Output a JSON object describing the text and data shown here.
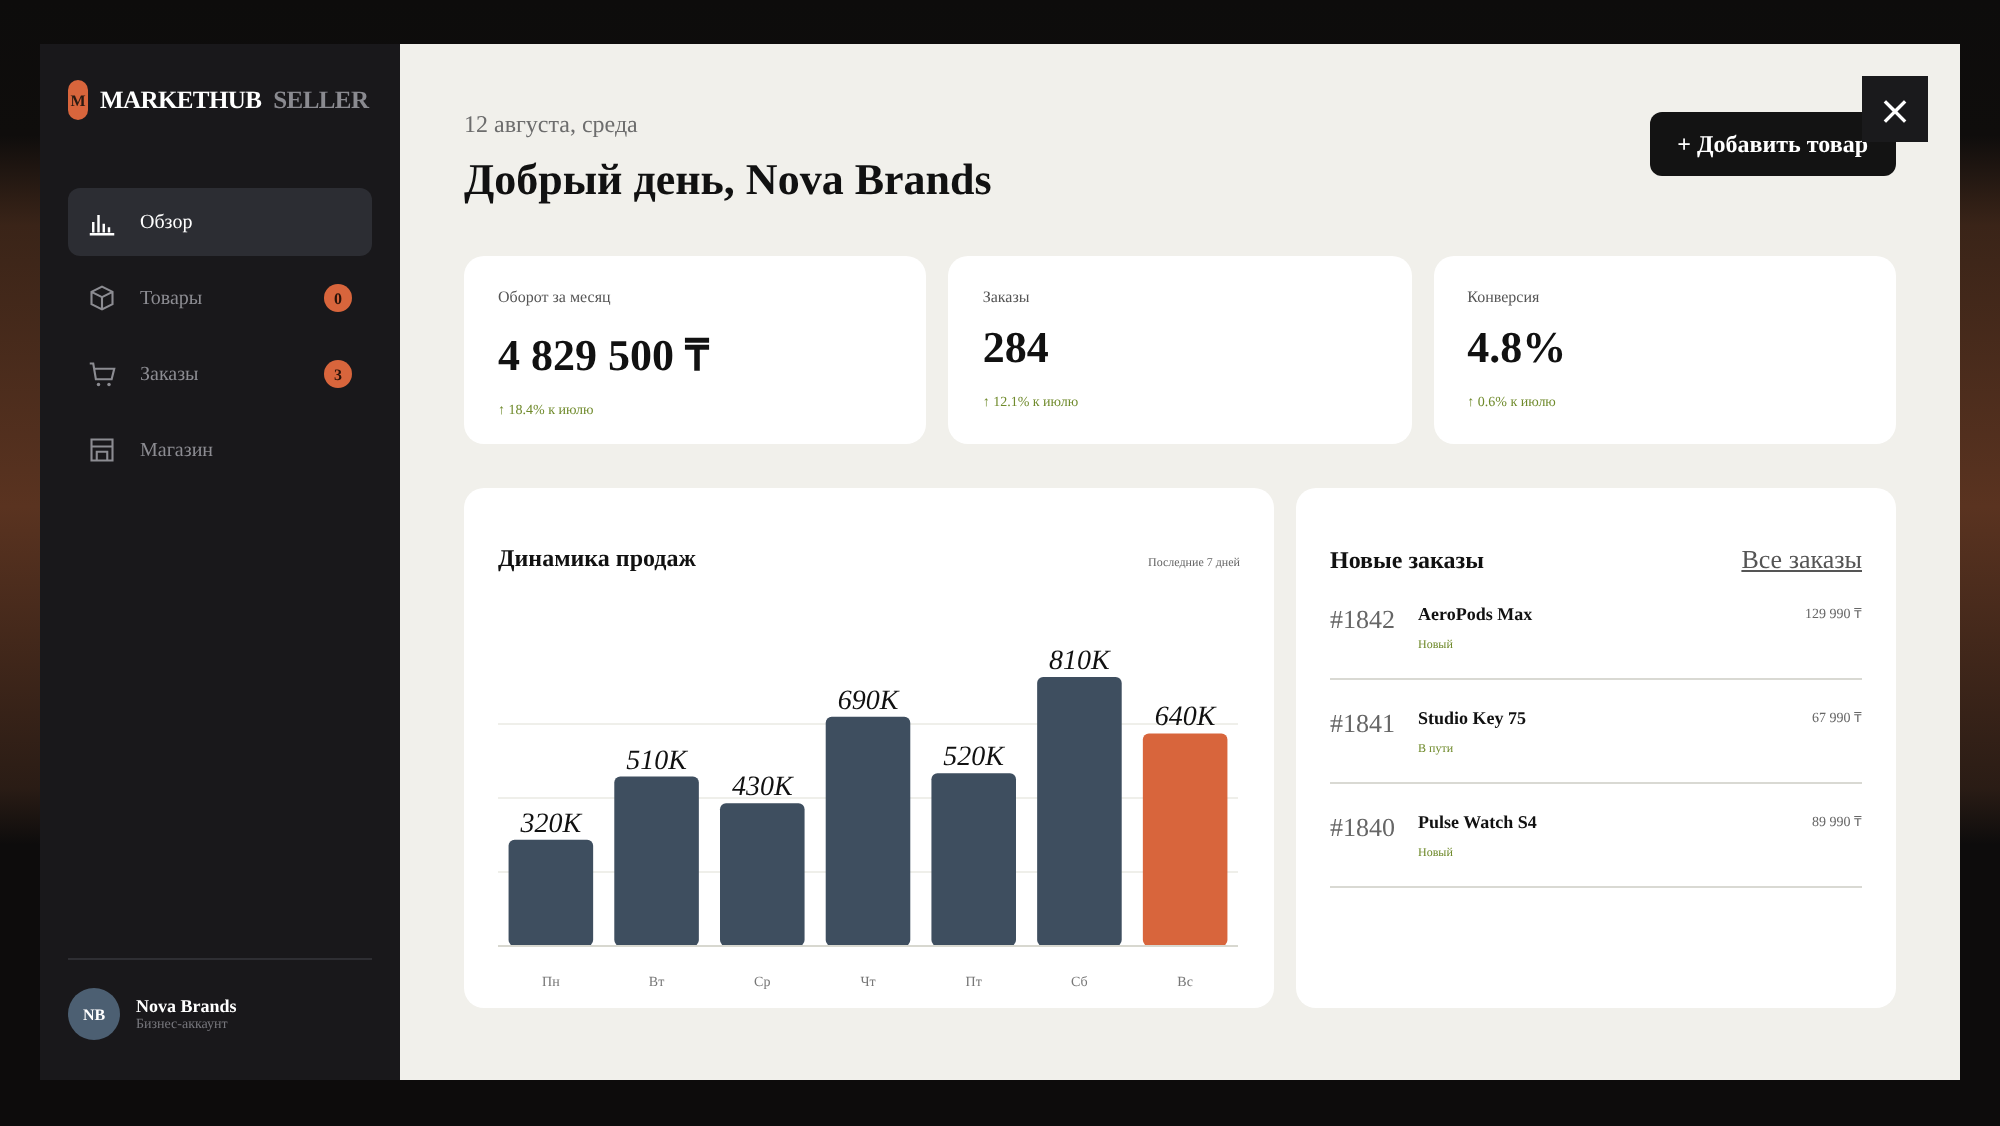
{
  "sidebar": {
    "logo": {
      "mark": "M",
      "name": "MARKETHUB",
      "suffix": "SELLER"
    },
    "items": [
      {
        "label": "Обзор",
        "kind": "overview",
        "selected": true
      },
      {
        "label": "Товары",
        "kind": "products",
        "selected": false,
        "badge": "0"
      },
      {
        "label": "Заказы",
        "kind": "orders",
        "selected": false,
        "badge": "3"
      },
      {
        "label": "Магазин",
        "kind": "store",
        "selected": false
      }
    ],
    "user": {
      "initials": "NB",
      "name": "Nova Brands",
      "role": "Бизнес-аккаунт"
    }
  },
  "header": {
    "date": "12 августа, среда",
    "greeting": "Добрый день, Nova Brands",
    "add_button": "+ Добавить товар",
    "close": "×"
  },
  "stats": [
    {
      "label": "Оборот за месяц",
      "value": "4 829 500 ₸",
      "delta": "↑ 18.4% к июлю"
    },
    {
      "label": "Заказы",
      "value": "284",
      "delta": "↑ 12.1% к июлю"
    },
    {
      "label": "Конверсия",
      "value": "4.8%",
      "delta": "↑ 0.6% к июлю"
    }
  ],
  "sales": {
    "title": "Динамика продаж",
    "period": "Последние 7 дней",
    "chart_data": {
      "type": "bar",
      "categories": [
        "Пн",
        "Вт",
        "Ср",
        "Чт",
        "Пт",
        "Сб",
        "Вс"
      ],
      "stacked": true,
      "series": [
        {
          "color": "#3e4e5f",
          "values": [
            320000,
            510000,
            430000,
            690000,
            520000,
            810000,
            null
          ],
          "value_labels": [
            "320K",
            "510K",
            "430K",
            "690K",
            "520K",
            "810K",
            null
          ]
        },
        {
          "color": "#d8653c",
          "values": [
            null,
            null,
            null,
            null,
            null,
            null,
            640000
          ],
          "value_labels": [
            null,
            null,
            null,
            null,
            null,
            null,
            "640K"
          ]
        }
      ]
    }
  },
  "orders": {
    "title": "Новые заказы",
    "all_link": "Все заказы",
    "rows": [
      {
        "number": "#1842",
        "product": "AeroPods Max",
        "status": "Новый",
        "price": "129 990 ₸"
      },
      {
        "number": "#1841",
        "product": "Studio Key 75",
        "status": "В пути",
        "price": "67 990 ₸"
      },
      {
        "number": "#1840",
        "product": "Pulse Watch S4",
        "status": "Новый",
        "price": "89 990 ₸"
      }
    ]
  }
}
